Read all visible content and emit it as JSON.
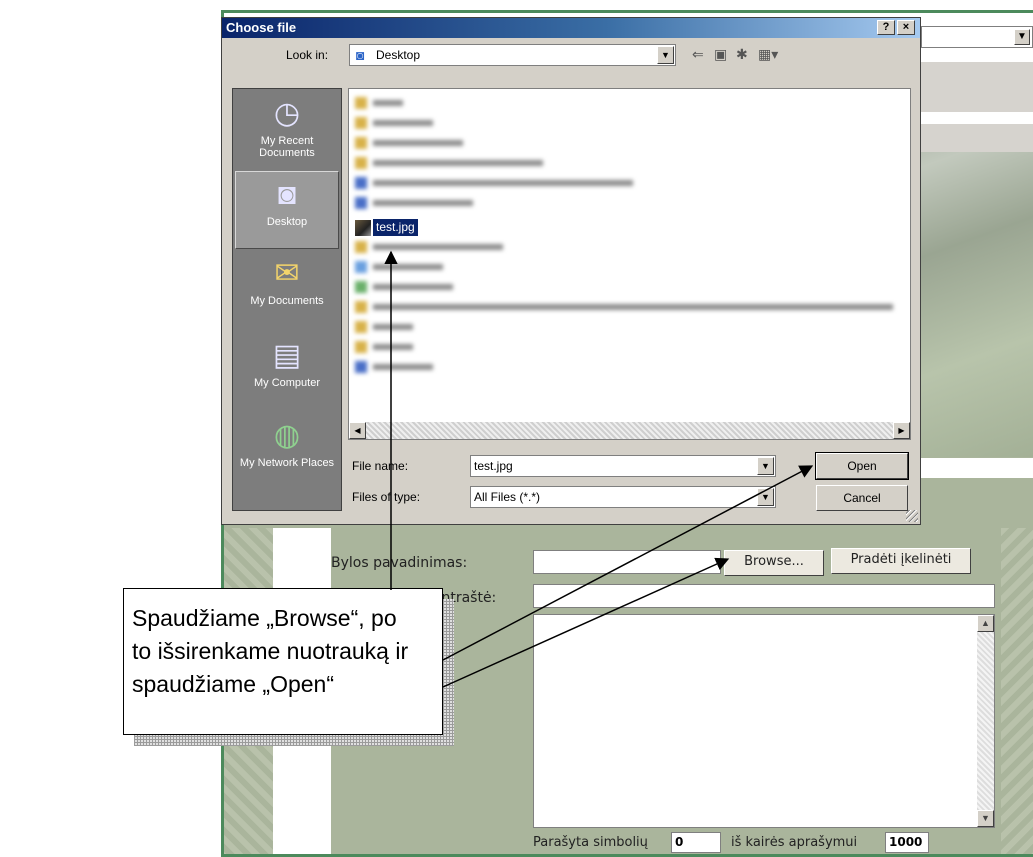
{
  "dialog": {
    "title": "Choose file",
    "help_button": "?",
    "close_button": "×",
    "look_in_label": "Look in:",
    "look_in_value": "Desktop",
    "places": [
      {
        "label": "My Recent Documents",
        "icon": "recent-documents-icon"
      },
      {
        "label": "Desktop",
        "icon": "desktop-icon"
      },
      {
        "label": "My Documents",
        "icon": "my-documents-icon"
      },
      {
        "label": "My Computer",
        "icon": "my-computer-icon"
      },
      {
        "label": "My Network Places",
        "icon": "network-places-icon"
      }
    ],
    "selected_file": "test.jpg",
    "file_name_label": "File name:",
    "file_name_value": "test.jpg",
    "file_type_label": "Files of type:",
    "file_type_value": "All Files (*.*)",
    "open_button": "Open",
    "cancel_button": "Cancel"
  },
  "form": {
    "file_label": "Bylos pavadinimas:",
    "browse_button": "Browse...",
    "upload_button": "Pradėti įkelinėti",
    "title_label": "Paveikslėlio antraštė:",
    "chars_written_label": "Parašyta simbolių",
    "chars_written_value": "0",
    "chars_left_label": "iš kairės aprašymui",
    "chars_left_value": "1000"
  },
  "callout": {
    "lines": [
      "Spaudžiame „Browse“, po",
      "to išsirenkame nuotrauką ir",
      "spaudžiame „Open“"
    ]
  },
  "colors": {
    "titlebar_start": "#0a246a",
    "page_background": "#aab59c",
    "page_border": "#4c8a5c"
  }
}
